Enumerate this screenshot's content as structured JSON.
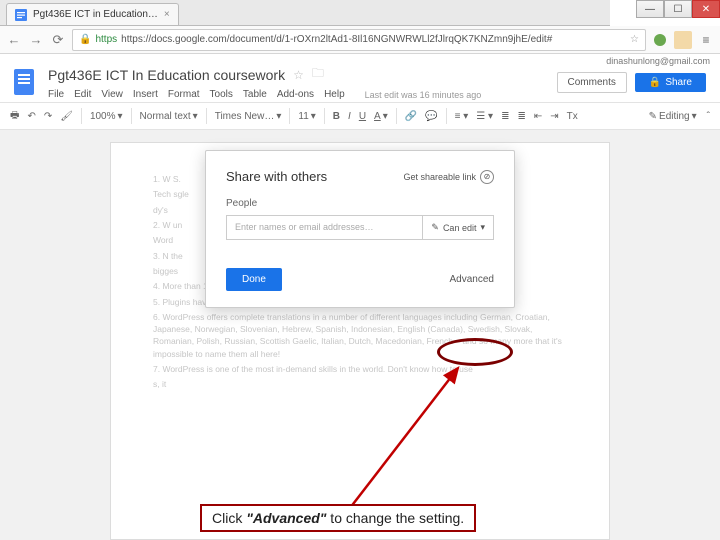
{
  "browser": {
    "tab_title": "Pgt436E ICT in Education…",
    "url": "https://docs.google.com/document/d/1-rOXrn2ltAd1-8Il16NGNWRWLl2fJlrqQK7KNZmn9jhE/edit#",
    "url_scheme": "https",
    "window_min": "—",
    "window_max": "☐",
    "window_close": "✕"
  },
  "docs": {
    "account": "dinashunlong@gmail.com",
    "title": "Pgt436E ICT In Education coursework",
    "menus": {
      "file": "File",
      "edit": "Edit",
      "view": "View",
      "insert": "Insert",
      "format": "Format",
      "tools": "Tools",
      "table": "Table",
      "addons": "Add-ons",
      "help": "Help"
    },
    "last_mod": "Last edit was 16 minutes ago",
    "comments": "Comments",
    "share": "Share"
  },
  "toolbar": {
    "zoom": "100%",
    "style": "Normal text",
    "font": "Times New…",
    "size": "11",
    "editing": "Editing"
  },
  "share_dialog": {
    "title": "Share with others",
    "get_link": "Get shareable link",
    "people": "People",
    "placeholder": "Enter names or email addresses…",
    "can_edit": "Can edit",
    "done": "Done",
    "advanced": "Advanced"
  },
  "doc_body": {
    "l1": "1. W                                                                                                                                  S.",
    "l2": "Tech                                                                                                                              sgle",
    "l3": "dy's",
    "l4": "2. W                                                                                                                              un",
    "l5": "Word",
    "l6": "3. N                                                                                                                              the",
    "l7": "bigges",
    "l8": "4. More than 19,000 WordPress plugins are available – 19,000!",
    "l9": "5. Plugins have been downloaded an estimated 285,000,000 times – million!",
    "l10": "6. WordPress offers complete translations in a number of different languages including German, Croatian, Japanese, Norwegian, Slovenian, Hebrew, Spanish, Indonesian, English (Canada), Swedish, Slovak, Romanian, Polish, Russian, Scottish Gaelic, Italian, Dutch, Macedonian, French – and so many more that it's impossible to name them all here!",
    "l11": "7. WordPress is one of the most in-demand skills in the world. Don't know how to use",
    "l12": "s, it"
  },
  "annotation": {
    "text_pre": "Click ",
    "text_em": "\"Advanced\"",
    "text_post": " to change the setting."
  }
}
